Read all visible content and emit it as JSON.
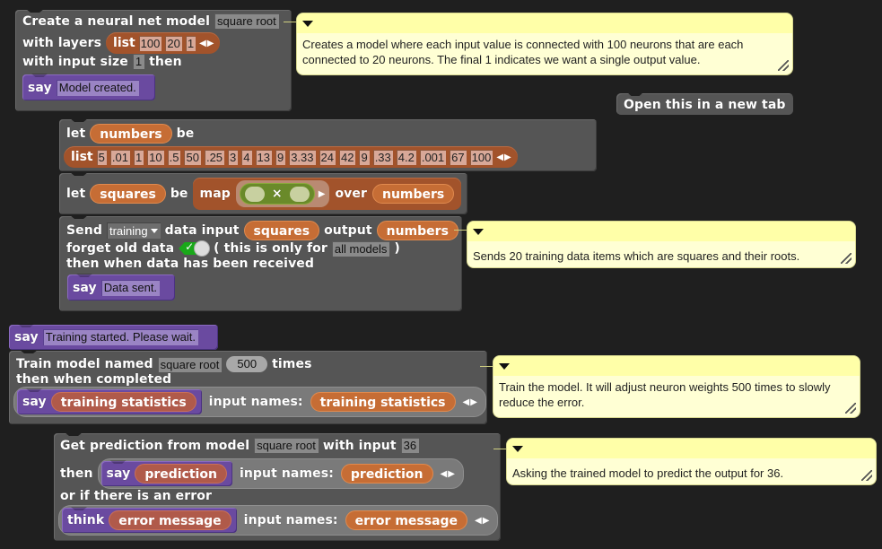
{
  "create_block": {
    "line1": "Create a neural net model",
    "model_name": "square root",
    "line2": "with layers",
    "list_kw": "list",
    "layers": [
      "100",
      "20",
      "1"
    ],
    "line3_a": "with input size",
    "input_size": "1",
    "line3_b": "then",
    "say_kw": "say",
    "say_text": "Model created."
  },
  "comment1": {
    "text": "Creates a model where each input value is connected with 100 neurons that are each connected to 20 neurons. The final 1 indicates we want a single output value."
  },
  "open_tab_button": {
    "label": "Open this in a new tab"
  },
  "let_numbers": {
    "let_kw": "let",
    "var": "numbers",
    "be_kw": "be",
    "list_kw": "list",
    "values": [
      "5",
      ".01",
      "1",
      "10",
      ".5",
      "50",
      ".25",
      "3",
      "4",
      "13",
      "9",
      "3.33",
      "24",
      "42",
      "9",
      ".33",
      "4.2",
      ".001",
      "67",
      "100"
    ]
  },
  "let_squares": {
    "let_kw": "let",
    "var": "squares",
    "be_kw": "be",
    "map_kw": "map",
    "op": "×",
    "over_kw": "over",
    "over_var": "numbers"
  },
  "send_block": {
    "send_kw": "Send",
    "mode": "training",
    "data_input_kw": "data input",
    "input_var": "squares",
    "output_kw": "output",
    "output_var": "numbers",
    "forget_kw": "forget old data",
    "forget_checked": true,
    "only_for_a": "( this is only for",
    "only_for_value": "all models",
    "only_for_b": ")",
    "then_kw": "then when data has been received",
    "say_kw": "say",
    "say_text": "Data sent."
  },
  "comment2": {
    "text": "Sends 20 training data items which are squares and their roots."
  },
  "say_training": {
    "say_kw": "say",
    "text": "Training started. Please wait."
  },
  "train_block": {
    "train_kw": "Train model named",
    "model_name": "square root",
    "times_value": "500",
    "times_kw": "times",
    "then_kw": "then when completed",
    "say_kw": "say",
    "say_var": "training statistics",
    "input_names_kw": "input names:",
    "param": "training statistics"
  },
  "comment3": {
    "text": "Train the model. It will adjust neuron weights 500 times to slowly reduce the error."
  },
  "predict_block": {
    "get_kw": "Get prediction from model",
    "model_name": "square root",
    "with_input_kw": "with input",
    "input_value": "36",
    "then_kw": "then",
    "say_kw": "say",
    "say_var": "prediction",
    "input_names_kw": "input names:",
    "param": "prediction",
    "error_kw": "or if there is an error",
    "think_kw": "think",
    "think_var": "error message",
    "error_input_names_kw": "input names:",
    "error_param": "error message"
  },
  "comment4": {
    "text": "Asking the trained model to predict the output for 36."
  }
}
